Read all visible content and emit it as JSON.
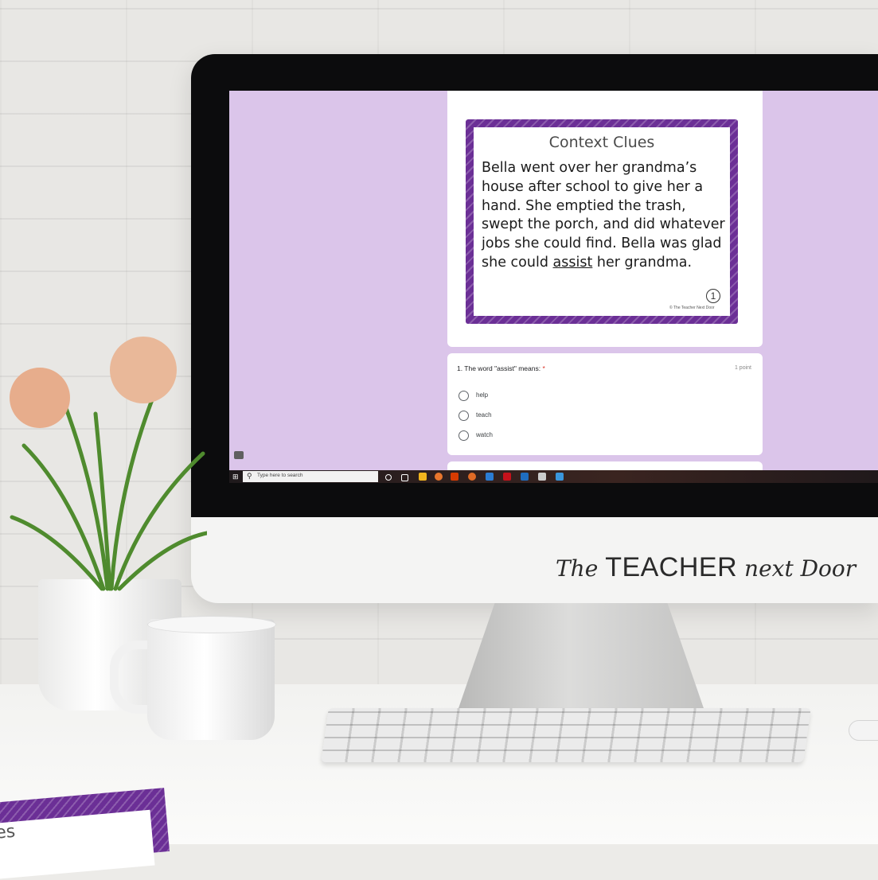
{
  "clue_card": {
    "title": "Context Clues",
    "text_before": "Bella went over her grandma’s house after school to give her a hand. She emptied the trash, swept the porch, and did whatever jobs she could find. Bella was glad she could ",
    "underlined_word": "assist",
    "text_after": " her grandma.",
    "card_number": "1",
    "copyright": "© The Teacher Next Door"
  },
  "question": {
    "label": "1. The word \"assist\" means:",
    "required_mark": " *",
    "points": "1 point",
    "options": [
      "help",
      "teach",
      "watch"
    ]
  },
  "taskbar": {
    "search_placeholder": "Type here to search",
    "search_icon": "search-icon",
    "start_icon": "windows-start-icon",
    "app_icon_colors": [
      "#ffffff",
      "#ffffff",
      "#f2b51e",
      "#e8762d",
      "#d83b01",
      "#e06a25",
      "#2b7cd3",
      "#c5121b",
      "#1f6dbf",
      "#cccccc",
      "#3a96dd"
    ]
  },
  "brand": {
    "the": "The ",
    "teacher": "TEACHER",
    "next_door": " next Door"
  },
  "corner_card": {
    "partial_title": "es"
  },
  "colors": {
    "form_background": "#dbc5ea",
    "card_frame": "#6b2f96"
  }
}
